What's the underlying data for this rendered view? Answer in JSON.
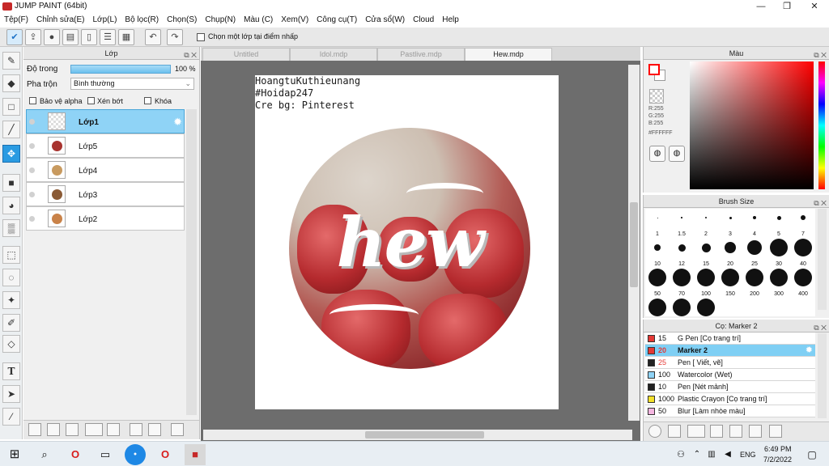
{
  "window": {
    "title": "JUMP PAINT (64bit)",
    "controls": [
      "—",
      "❐",
      "✕"
    ]
  },
  "menu": [
    "Tệp(F)",
    "Chỉnh sửa(E)",
    "Lớp(L)",
    "Bộ lọc(R)",
    "Chọn(S)",
    "Chụp(N)",
    "Màu (C)",
    "Xem(V)",
    "Công cụ(T)",
    "Cửa sổ(W)",
    "Cloud",
    "Help"
  ],
  "toolbar": {
    "pick_layer_label": "Chọn một lớp tại điểm nhấp",
    "icons": [
      "check-badge-icon",
      "export-icon",
      "speech-bubble-icon",
      "comment-box-icon",
      "document-icon",
      "list-icon",
      "checklist-icon",
      "undo-icon",
      "redo-icon"
    ]
  },
  "tools": [
    "brush-icon",
    "eraser-icon",
    "shape-icon",
    "line-icon",
    "move-icon",
    "fill-square-icon",
    "bucket-icon",
    "gradient-icon",
    "rect-select-icon",
    "lasso-icon",
    "magic-wand-icon",
    "select-pen-icon",
    "select-eraser-icon",
    "text-icon",
    "pointer-icon",
    "eyedropper-icon"
  ],
  "layers": {
    "title": "Lớp",
    "opacity_label": "Độ trong",
    "opacity_value": "100 %",
    "opacity_level": 1.0,
    "blend_label": "Pha trộn",
    "blend_value": "Bình thường",
    "protect_alpha": "Bảo vệ alpha",
    "clip": "Xén bớt",
    "lock": "Khóa",
    "items": [
      {
        "name": "Lớp1",
        "active": true,
        "color": "#ffffff"
      },
      {
        "name": "Lớp5",
        "active": false,
        "color": "#a8332f"
      },
      {
        "name": "Lớp4",
        "active": false,
        "color": "#c89a5f"
      },
      {
        "name": "Lớp3",
        "active": false,
        "color": "#8a5a35"
      },
      {
        "name": "Lớp2",
        "active": false,
        "color": "#c98248"
      }
    ]
  },
  "tabs": [
    {
      "label": "Untitled",
      "active": false
    },
    {
      "label": "Idol.mdp",
      "active": false
    },
    {
      "label": "Pastlive.mdp",
      "active": false
    },
    {
      "label": "Hew.mdp",
      "active": true
    }
  ],
  "canvas": {
    "lines": [
      "HoangtuKuthieunang",
      "#Hoidap247",
      "Cre bg: Pinterest"
    ],
    "artwork_text": "hew"
  },
  "color": {
    "title": "Màu",
    "r": "R:255",
    "g": "G:255",
    "b": "B:255",
    "hex": "#FFFFFF",
    "main_color": "#ff0000",
    "sub_color": "#ffffff"
  },
  "brush": {
    "title": "Brush Size",
    "sizes": [
      "1",
      "1.5",
      "2",
      "3",
      "4",
      "5",
      "7",
      "10",
      "12",
      "15",
      "20",
      "25",
      "30",
      "40",
      "50",
      "70",
      "100",
      "150",
      "200",
      "300",
      "400",
      "",
      "",
      ""
    ]
  },
  "pens": {
    "title": "Cọ: Marker 2",
    "items": [
      {
        "size": "15",
        "name": "G Pen [Cọ trang trí]",
        "color": "#e53935",
        "active": false
      },
      {
        "size": "20",
        "name": "Marker 2",
        "color": "#e53935",
        "active": true
      },
      {
        "size": "25",
        "name": "Pen [ Viết, vẽ]",
        "color": "#222222",
        "active": false
      },
      {
        "size": "100",
        "name": "Watercolor (Wet)",
        "color": "#8fd3f6",
        "active": false
      },
      {
        "size": "10",
        "name": "Pen [Nét mảnh]",
        "color": "#222222",
        "active": false
      },
      {
        "size": "1000",
        "name": "Plastic Crayon [Cọ trang trí]",
        "color": "#f4e12a",
        "active": false
      },
      {
        "size": "50",
        "name": "Blur [Làm nhòe màu]",
        "color": "#f4b6e0",
        "active": false
      }
    ]
  },
  "taskbar": {
    "lang": "ENG",
    "time": "6:49 PM",
    "date": "7/2/2022"
  }
}
